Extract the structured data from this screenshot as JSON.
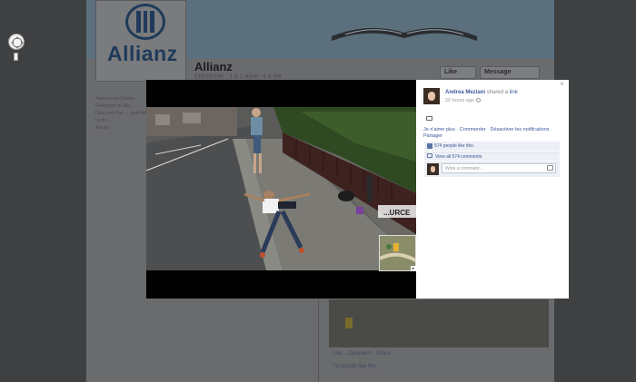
{
  "background_page": {
    "logo_text": "Allianz",
    "page_name": "Allianz",
    "page_subtitle": "Entreprise · 1 à 1 aime, 4 a été",
    "like_button": "Like",
    "message_button": "Message",
    "sidebar_heading": "Assurance Comp...",
    "sidebar_text": "Welcome to Ma... Discover the ... and help us to...",
    "sidebar_link": "About",
    "post_actions": "Like · Comment · Share",
    "post_likes": "73 people like this."
  },
  "photo_post": {
    "author": "Andrea Meziani",
    "verb": "shared a",
    "object": "link",
    "time": "20 hours ago",
    "actions": [
      "Je n'aime plus",
      "Commenter",
      "Désactiver les notifications",
      "Partager"
    ],
    "likes_text": "574 people like this.",
    "view_comments": "View all 574 comments",
    "comment_placeholder": "Write a comment...",
    "close_label": "x"
  },
  "photo_scene": {
    "sign_text": "...URCE"
  },
  "icons": [
    "close-icon",
    "globe-icon",
    "photo-icon",
    "thumbs-up-icon",
    "comment-icon",
    "camera-icon",
    "navigation-compass-icon"
  ],
  "colors": {
    "link_blue": "#3b5998",
    "brand_navy": "#1f3a5a",
    "overlay_dark": "#3f4042",
    "panel_bg": "#ffffff",
    "light_blue_row": "#eceff5"
  }
}
